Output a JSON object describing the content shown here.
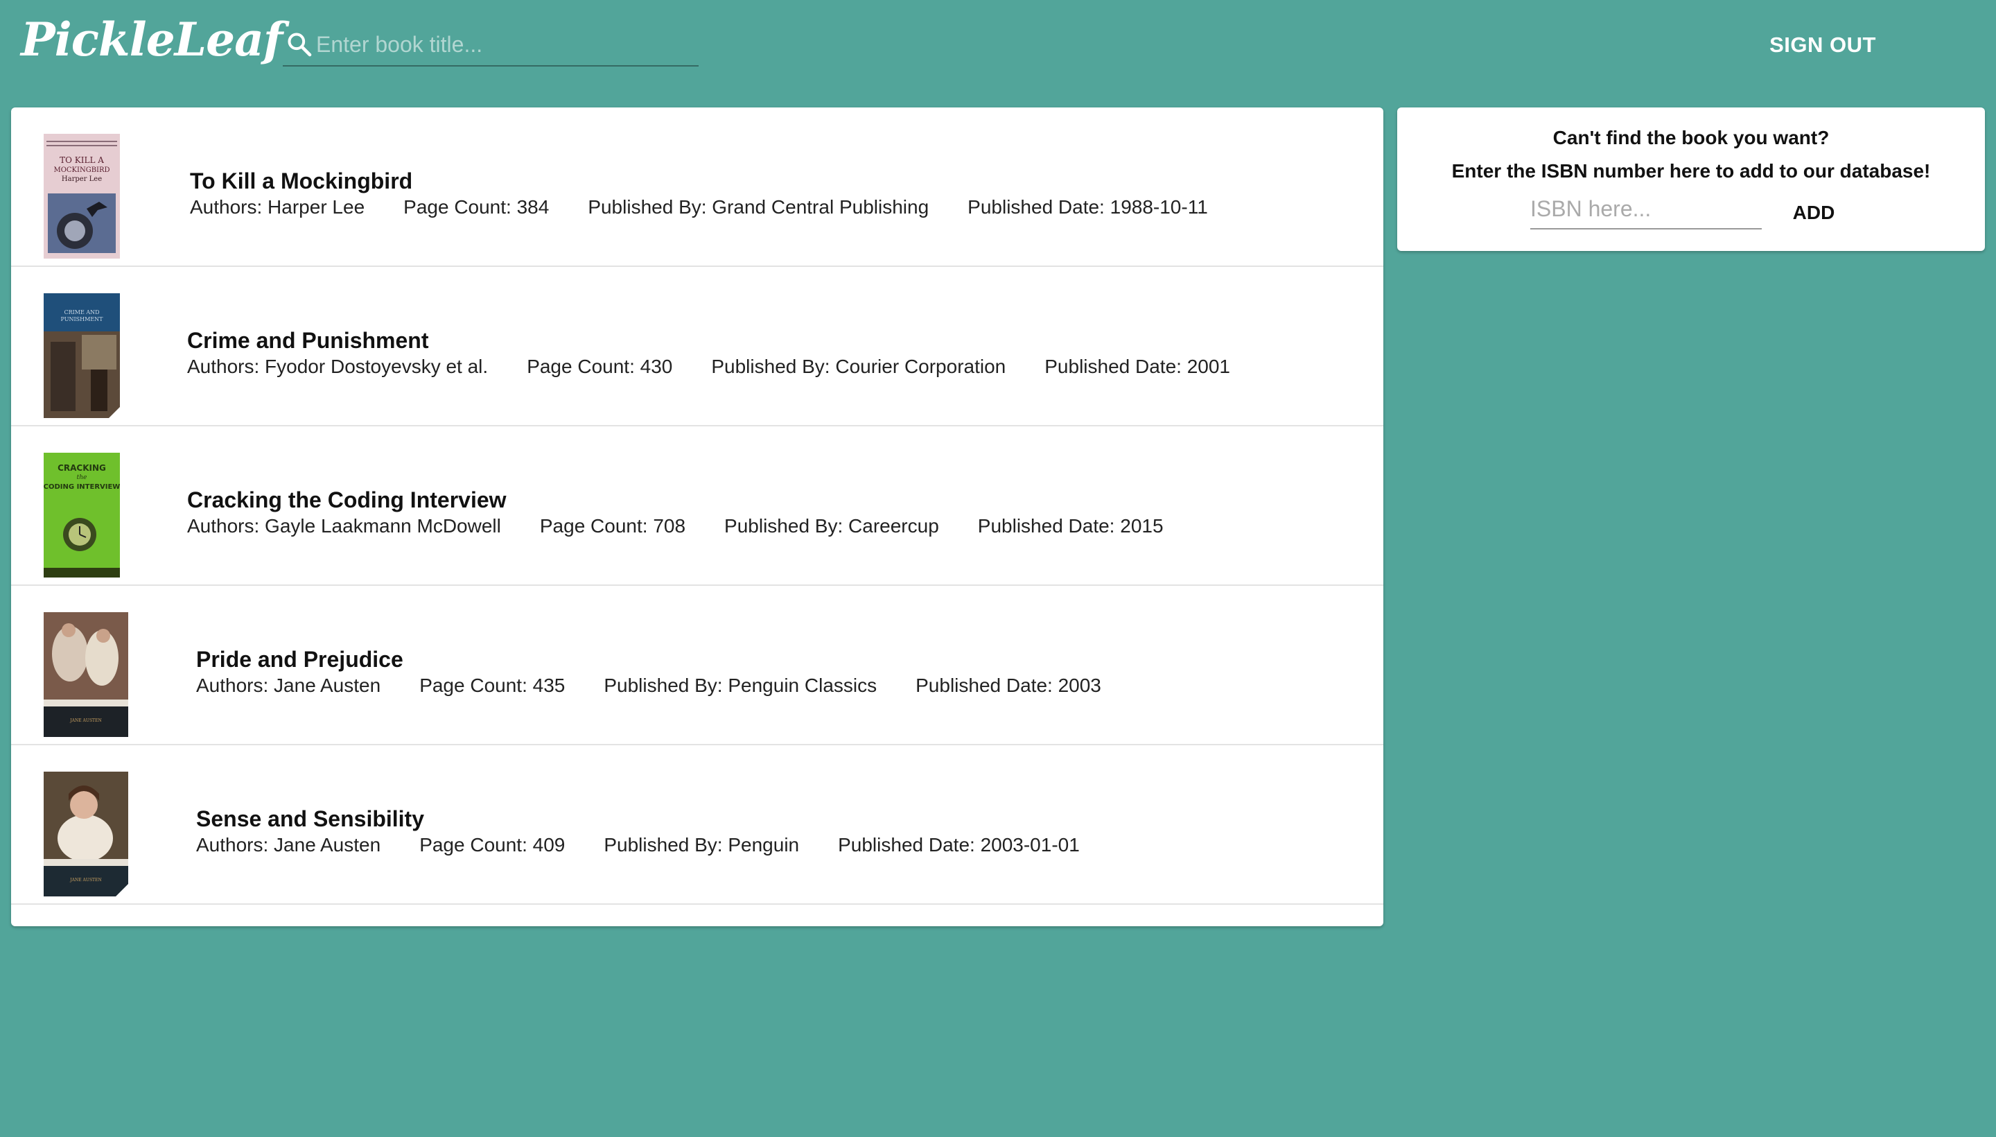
{
  "header": {
    "logo": "PickleLeaf",
    "search_placeholder": "Enter book title...",
    "signout_label": "SIGN OUT"
  },
  "books": [
    {
      "title": "To Kill a Mockingbird",
      "authors": "Authors: Harper Lee",
      "page_count": "Page Count: 384",
      "publisher": "Published By: Grand Central Publishing",
      "published_date": "Published Date: 1988-10-11",
      "cover_text": "TO KILL A MOCKINGBIRD",
      "cover_author": "Harper Lee"
    },
    {
      "title": "Crime and Punishment",
      "authors": "Authors: Fyodor Dostoyevsky et al.",
      "page_count": "Page Count: 430",
      "publisher": "Published By: Courier Corporation",
      "published_date": "Published Date: 2001",
      "cover_text": "CRIME AND PUNISHMENT"
    },
    {
      "title": "Cracking the Coding Interview",
      "authors": "Authors: Gayle Laakmann McDowell",
      "page_count": "Page Count: 708",
      "publisher": "Published By: Careercup",
      "published_date": "Published Date: 2015",
      "cover_text": "CRACKING the CODING INTERVIEW"
    },
    {
      "title": "Pride and Prejudice",
      "authors": "Authors: Jane Austen",
      "page_count": "Page Count: 435",
      "publisher": "Published By: Penguin Classics",
      "published_date": "Published Date: 2003"
    },
    {
      "title": "Sense and Sensibility",
      "authors": "Authors: Jane Austen",
      "page_count": "Page Count: 409",
      "publisher": "Published By: Penguin",
      "published_date": "Published Date: 2003-01-01"
    }
  ],
  "isbn_panel": {
    "line1": "Can't find the book you want?",
    "line2": "Enter the ISBN number here to add to our database!",
    "placeholder": "ISBN here...",
    "add_label": "ADD"
  },
  "colors": {
    "background": "#52a59a",
    "card": "#ffffff"
  }
}
